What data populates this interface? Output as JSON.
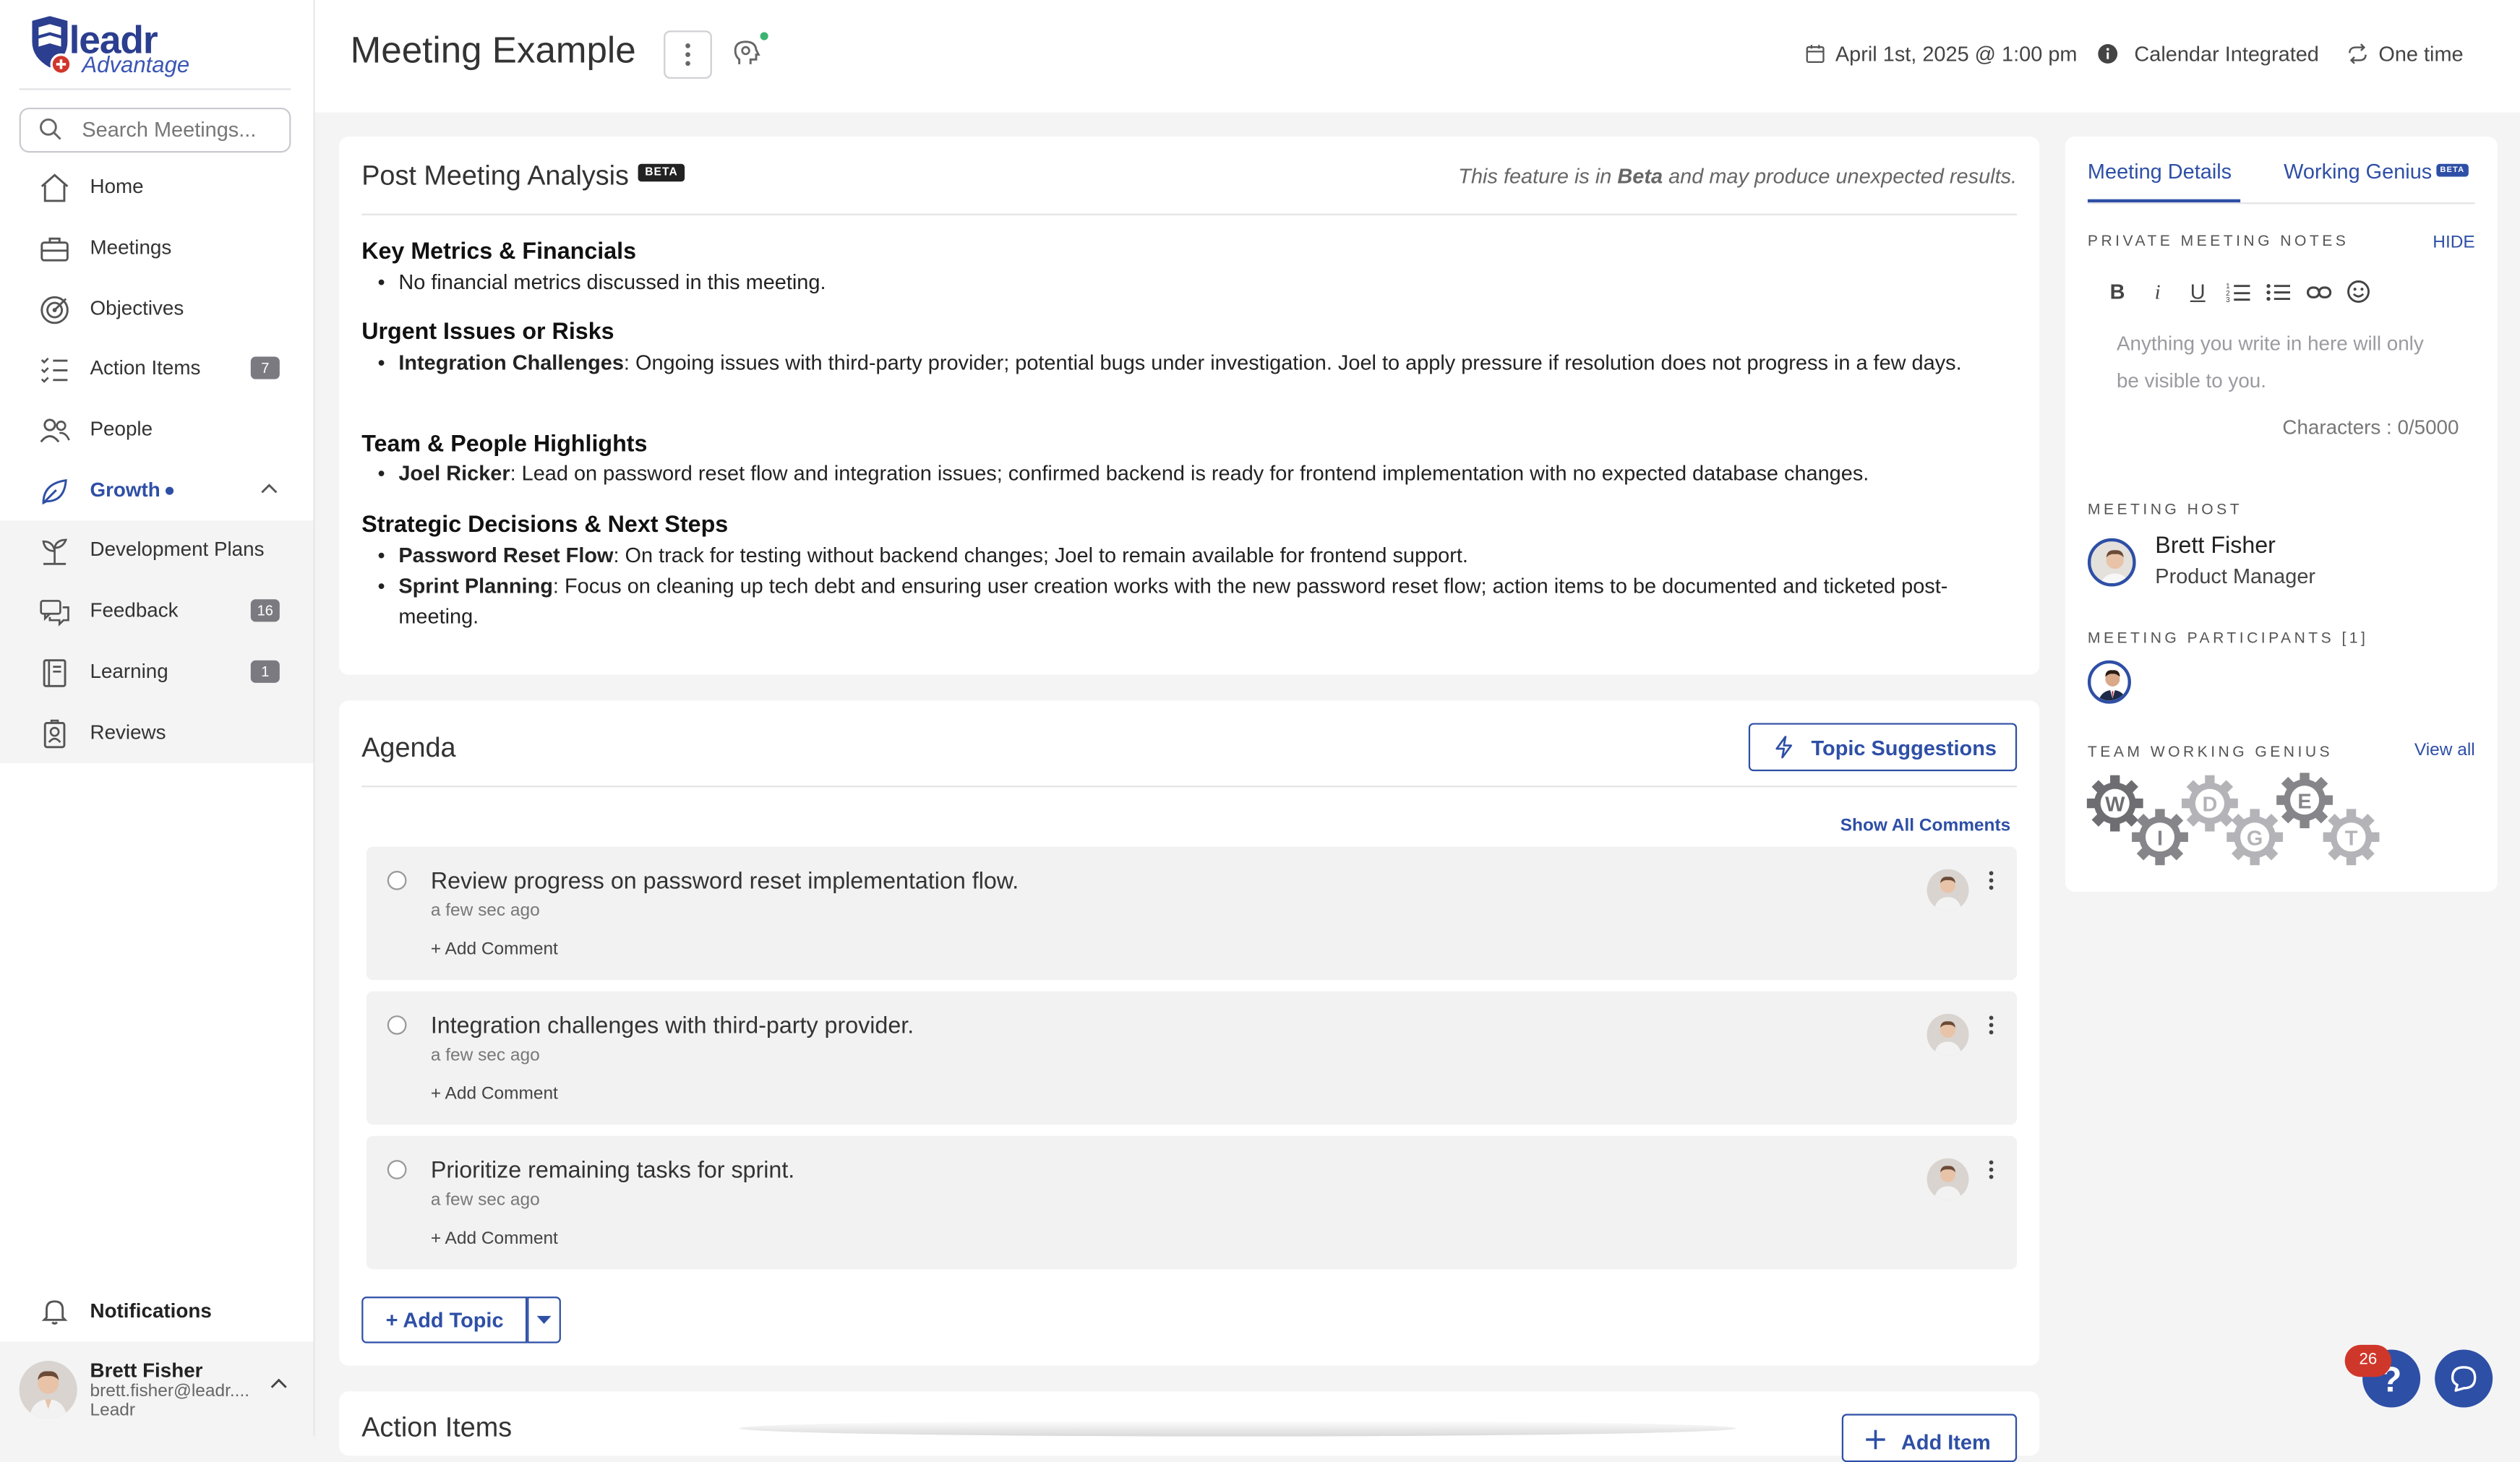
{
  "app": {
    "logo_text": "leadr",
    "logo_sub": "Advantage"
  },
  "sidebar": {
    "search_placeholder": "Search Meetings...",
    "items": [
      {
        "label": "Home",
        "icon": "home-icon"
      },
      {
        "label": "Meetings",
        "icon": "briefcase-icon"
      },
      {
        "label": "Objectives",
        "icon": "target-icon"
      },
      {
        "label": "Action Items",
        "icon": "checklist-icon",
        "count": "7"
      },
      {
        "label": "People",
        "icon": "people-icon"
      },
      {
        "label": "Growth",
        "icon": "leaf-icon"
      },
      {
        "label": "Development Plans",
        "icon": "plant-icon"
      },
      {
        "label": "Feedback",
        "icon": "chat-bubbles-icon",
        "count": "16"
      },
      {
        "label": "Learning",
        "icon": "book-icon",
        "count": "1"
      },
      {
        "label": "Reviews",
        "icon": "badge-icon"
      }
    ],
    "notifications_label": "Notifications",
    "user": {
      "name": "Brett Fisher",
      "email": "brett.fisher@leadr....",
      "org": "Leadr"
    }
  },
  "header": {
    "title": "Meeting Example",
    "date": "April 1st, 2025 @ 1:00 pm",
    "calendar": "Calendar Integrated",
    "recurrence": "One time"
  },
  "analysis": {
    "title": "Post Meeting Analysis",
    "beta": "BETA",
    "note_pre": "This feature is in ",
    "note_bold": "Beta",
    "note_post": " and may produce unexpected results.",
    "sections": [
      {
        "heading": "Key Metrics & Financials",
        "bullets": [
          {
            "bold": "",
            "text": "No financial metrics discussed in this meeting."
          }
        ]
      },
      {
        "heading": "Urgent Issues or Risks",
        "bullets": [
          {
            "bold": "Integration Challenges",
            "text": ": Ongoing issues with third-party provider; potential bugs under investigation. Joel to apply pressure if resolution does not progress in a few days."
          }
        ]
      },
      {
        "heading": "Team & People Highlights",
        "bullets": [
          {
            "bold": "Joel Ricker",
            "text": ": Lead on password reset flow and integration issues; confirmed backend is ready for frontend implementation with no expected database changes."
          }
        ]
      },
      {
        "heading": "Strategic Decisions & Next Steps",
        "bullets": [
          {
            "bold": "Password Reset Flow",
            "text": ": On track for testing without backend changes; Joel to remain available for frontend support."
          },
          {
            "bold": "Sprint Planning",
            "text": ": Focus on cleaning up tech debt and ensuring user creation works with the new password reset flow; action items to be documented and ticketed post-meeting."
          }
        ]
      }
    ]
  },
  "agenda": {
    "title": "Agenda",
    "topic_suggestions": "Topic Suggestions",
    "show_all_comments": "Show All Comments",
    "items": [
      {
        "title": "Review progress on password reset implementation flow.",
        "time": "a few sec ago",
        "add_comment": "+ Add Comment"
      },
      {
        "title": "Integration challenges with third-party provider.",
        "time": "a few sec ago",
        "add_comment": "+ Add Comment"
      },
      {
        "title": "Prioritize remaining tasks for sprint.",
        "time": "a few sec ago",
        "add_comment": "+ Add Comment"
      }
    ],
    "add_topic": "+ Add Topic"
  },
  "action_items": {
    "title": "Action Items",
    "add_item": "Add Item"
  },
  "right_panel": {
    "tab_details": "Meeting Details",
    "tab_genius": "Working Genius",
    "tab_genius_badge": "BETA",
    "private_notes_label": "PRIVATE MEETING NOTES",
    "hide": "HIDE",
    "notes_placeholder": "Anything you write in here will only be visible to you.",
    "characters": "Characters : 0/5000",
    "host_label": "MEETING HOST",
    "host_name": "Brett Fisher",
    "host_role": "Product Manager",
    "participants_label": "MEETING PARTICIPANTS [1]",
    "genius_label": "TEAM WORKING GENIUS",
    "view_all": "View all",
    "genius_letters": [
      "W",
      "I",
      "D",
      "G",
      "E",
      "T"
    ]
  },
  "help": {
    "badge": "26"
  },
  "colors": {
    "brand": "#2e4fa6",
    "badge_red": "#d0372b"
  }
}
